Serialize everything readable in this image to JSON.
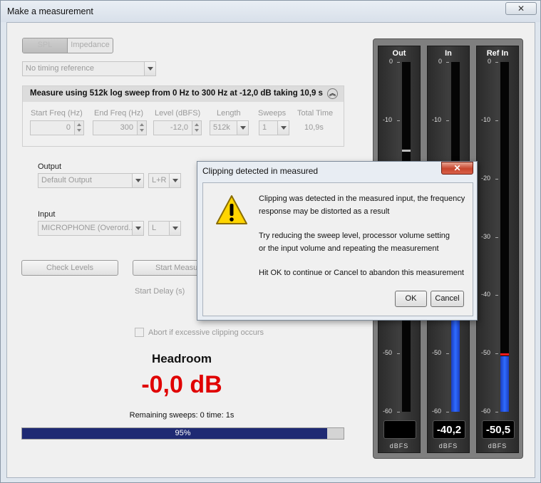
{
  "window": {
    "title": "Make a measurement",
    "close_label": "✕"
  },
  "mode_toggle": {
    "spl": "SPL",
    "impedance": "Impedance"
  },
  "timing_reference": {
    "value": "No timing reference"
  },
  "sweep_group": {
    "header": "Measure using 512k log sweep from 0 Hz to 300 Hz at -12,0 dB taking 10,9 s",
    "collapse_icon": "double-chevron-up",
    "labels": {
      "start_freq": "Start Freq (Hz)",
      "end_freq": "End Freq (Hz)",
      "level": "Level (dBFS)",
      "length": "Length",
      "sweeps": "Sweeps",
      "total_time": "Total Time"
    },
    "values": {
      "start_freq": "0",
      "end_freq": "300",
      "level": "-12,0",
      "length": "512k",
      "sweeps": "1",
      "total_time": "10,9s"
    }
  },
  "output": {
    "label": "Output",
    "device": "Default Output",
    "channel": "L+R"
  },
  "input": {
    "label": "Input",
    "device": "MICROPHONE (Overord...",
    "channel": "L"
  },
  "buttons": {
    "check_levels": "Check Levels",
    "start_measuring": "Start Measu"
  },
  "start_delay_label": "Start Delay (s)",
  "abort_checkbox": {
    "label": "Abort if excessive clipping occurs",
    "checked": false
  },
  "headroom": {
    "title": "Headroom",
    "value": "-0,0 dB"
  },
  "remaining": {
    "text": "Remaining sweeps: 0   time: 1s"
  },
  "progress": {
    "percent": 95,
    "label": "95%"
  },
  "meters": {
    "scale_min": -60,
    "scale_max": 0,
    "ticks": [
      "0",
      "-10",
      "-20",
      "-30",
      "-40",
      "-50",
      "-60"
    ],
    "unit": "dBFS",
    "channels": [
      {
        "title": "Out",
        "readout": "",
        "level": null,
        "peak": -15
      },
      {
        "title": "In",
        "readout": "-40,2",
        "level": -40.2,
        "peak": null
      },
      {
        "title": "Ref In",
        "readout": "-50,5",
        "level": -50.5,
        "peak": -50
      }
    ],
    "colors": {
      "fill": "#2f6cff",
      "peak_out": "#bbbbbb",
      "peak_ref": "#ff1a1a"
    }
  },
  "dialog": {
    "title": "Clipping detected in measured",
    "close_label": "✕",
    "icon": "warning-icon",
    "lines": [
      "Clipping was detected in the measured input, the frequency",
      "response may be distorted as a result",
      "Try reducing the sweep level, processor volume setting",
      "or the input volume and repeating the measurement",
      "Hit OK to continue or Cancel to abandon this measurement"
    ],
    "ok": "OK",
    "cancel": "Cancel"
  }
}
